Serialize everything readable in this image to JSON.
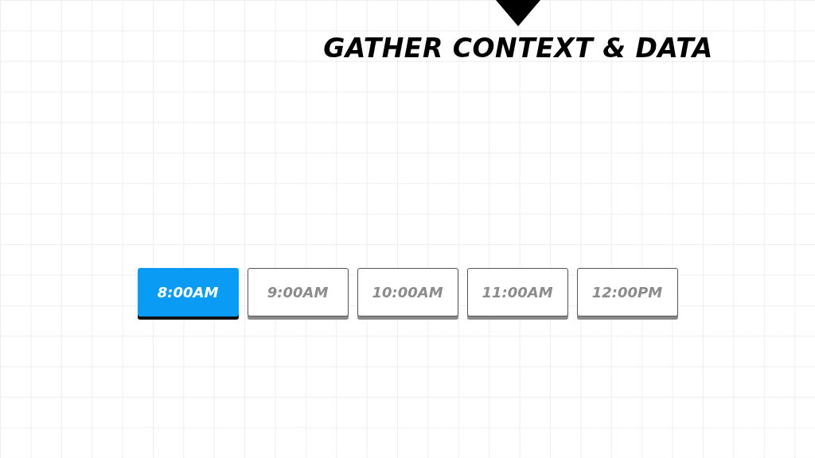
{
  "heading": {
    "title": "GATHER CONTEXT & DATA"
  },
  "time_slots": [
    {
      "label": "8:00AM",
      "selected": true
    },
    {
      "label": "9:00AM",
      "selected": false
    },
    {
      "label": "10:00AM",
      "selected": false
    },
    {
      "label": "11:00AM",
      "selected": false
    },
    {
      "label": "12:00PM",
      "selected": false
    }
  ]
}
